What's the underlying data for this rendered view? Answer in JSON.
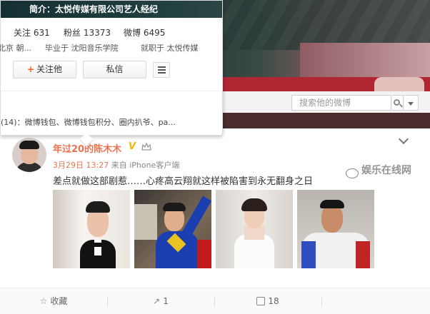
{
  "profile_card": {
    "intro": "简介：太悦传媒有限公司艺人经纪",
    "stats": {
      "follow_label": "关注 631",
      "fans_label": "粉丝 13373",
      "weibo_label": "微博 6495"
    },
    "info": {
      "location": "北京 朝...",
      "school": "毕业于 沈阳音乐学院",
      "work": "就职于 太悦传媒"
    },
    "follow_button": "关注他",
    "message_button": "私信",
    "tags": "(14)：微博钱包、微博钱包积分、圈内扒爷、pa..."
  },
  "search": {
    "placeholder": "搜索他的微博"
  },
  "post": {
    "username": "年过20的陈木木",
    "verified_mark": "V",
    "date": "3月29日 13:27",
    "source": " 来自 iPhone客户端",
    "text": "差点就做这部剧惹……心疼高云翔就这样被陷害到永无翻身之日",
    "photos": [
      "tuxedo-portrait",
      "superman-costume",
      "bride-portrait",
      "racing-suit-portrait"
    ]
  },
  "actions": {
    "favorite_label": "收藏",
    "repost_count": "1",
    "comment_count": "18",
    "like_label": ""
  },
  "watermark": "娱乐在线网",
  "colors": {
    "accent_orange": "#eb7350",
    "verified_gold": "#f5b400",
    "link_blue": "#3a73b8"
  }
}
